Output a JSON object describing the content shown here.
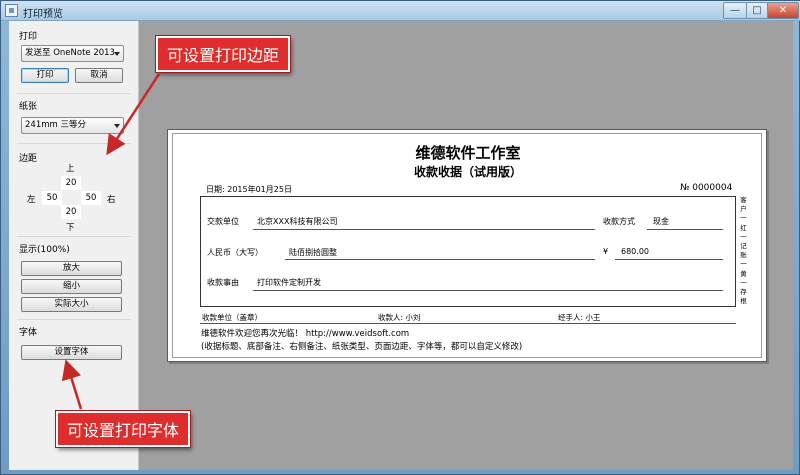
{
  "window": {
    "title": "打印预览",
    "min_glyph": "—",
    "max_glyph": "□",
    "close_glyph": "✕"
  },
  "panel": {
    "print": {
      "label": "打印",
      "printer": "发送至 OneNote 2013",
      "print_button": "打印",
      "cancel_button": "取消"
    },
    "paper": {
      "label": "纸张",
      "size": "241mm 三等分"
    },
    "margins": {
      "label": "边距",
      "top_label": "上",
      "bottom_label": "下",
      "left_label": "左",
      "right_label": "右",
      "top": "20",
      "bottom": "20",
      "left": "50",
      "right": "50"
    },
    "zoom": {
      "label": "显示(100%)",
      "zoom_in": "放大",
      "zoom_out": "缩小",
      "actual_size": "实际大小"
    },
    "font": {
      "label": "字体",
      "set_font": "设置字体"
    }
  },
  "receipt": {
    "title": "维德软件工作室",
    "subtitle": "收款收据（试用版）",
    "date": "日期:  2015年01月25日",
    "number": "№ 0000004",
    "payer_label": "交款单位",
    "payer_value": "北京XXX科技有限公司",
    "payment_method_label": "收款方式",
    "payment_method_value": "现金",
    "rmb_label": "人民币（大写）",
    "rmb_value": "陆佰捌拾圆整",
    "amount_symbol": "¥",
    "amount_value": "680.00",
    "reason_label": "收款事由",
    "reason_value": "打印软件定制开发",
    "side_note": "客户一红一记账一黄一存根",
    "footer_unit": "收款单位（盖章）",
    "footer_payee": "收款人:  小刘",
    "footer_handler": "经手人:  小王",
    "note_line1": "维德软件欢迎您再次光临！  http://www.veidsoft.com",
    "note_line2": "(收据标题、底部备注、右侧备注、纸张类型、页面边距、字体等，都可以自定义修改)"
  },
  "annotations": {
    "margin_callout": "可设置打印边距",
    "font_callout": "可设置打印字体"
  },
  "colors": {
    "callout_bg": "#dd2d2d",
    "preview_bg": "#a0a0a0",
    "panel_bg": "#f0f0f0"
  }
}
